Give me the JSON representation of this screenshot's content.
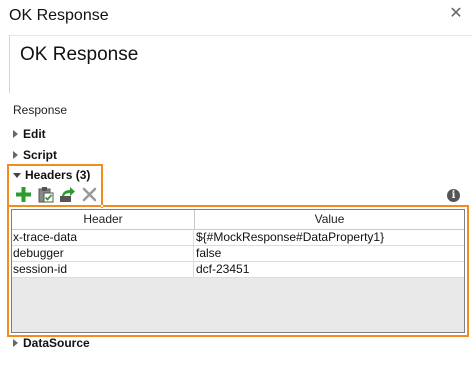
{
  "window": {
    "title": "OK Response",
    "close_glyph": "✕"
  },
  "panel": {
    "heading": "OK Response",
    "section_label": "Response"
  },
  "tree": {
    "edit": "Edit",
    "script": "Script",
    "headers": "Headers (3)",
    "datasource": "DataSource"
  },
  "toolbar": {
    "icons": [
      "add-icon",
      "paste-icon",
      "export-icon",
      "delete-icon"
    ],
    "info_glyph": "i"
  },
  "headers_table": {
    "columns": [
      "Header",
      "Value"
    ],
    "rows": [
      {
        "header": "x-trace-data",
        "value": "${#MockResponse#DataProperty1}"
      },
      {
        "header": "debugger",
        "value": "false"
      },
      {
        "header": "session-id",
        "value": "dcf-23451"
      }
    ]
  },
  "colors": {
    "highlight": "#f28c1d",
    "add": "#2e9b2e",
    "delete": "#9a9a9a"
  }
}
